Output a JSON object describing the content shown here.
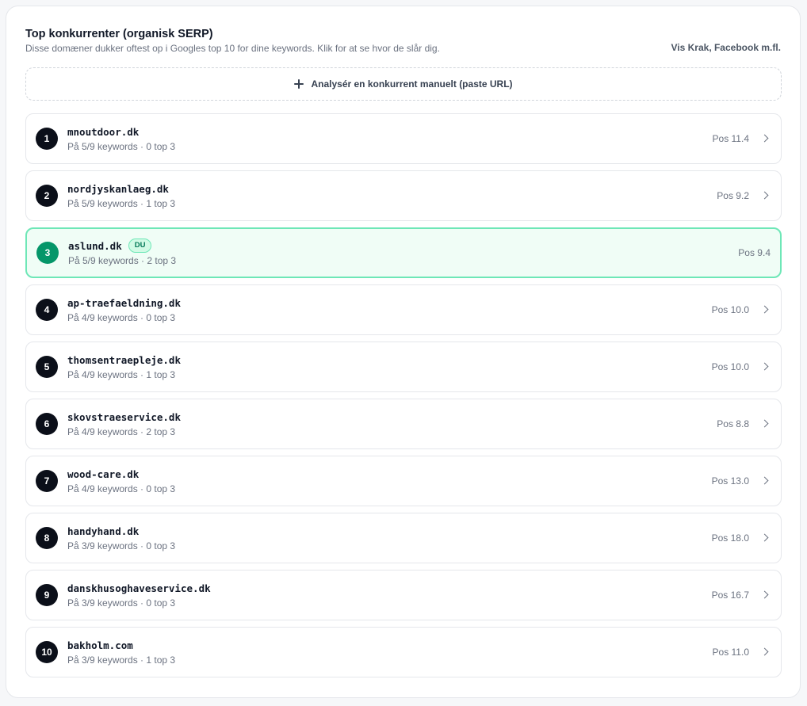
{
  "panel": {
    "title": "Top konkurrenter (organisk SERP)",
    "subtitle": "Disse domæner dukker oftest op i Googles top 10 for dine keywords. Klik for at se hvor de slår dig.",
    "toggle_label": "Vis Krak, Facebook m.fl.",
    "add_label": "Analysér en konkurrent manuelt (paste URL)"
  },
  "competitors": [
    {
      "rank": "1",
      "domain": "mnoutdoor.dk",
      "meta": "På 5/9 keywords · 0 top 3",
      "pos": "Pos 11.4",
      "is_self": false
    },
    {
      "rank": "2",
      "domain": "nordjyskanlaeg.dk",
      "meta": "På 5/9 keywords · 1 top 3",
      "pos": "Pos 9.2",
      "is_self": false
    },
    {
      "rank": "3",
      "domain": "aslund.dk",
      "badge": "DU",
      "meta": "På 5/9 keywords · 2 top 3",
      "pos": "Pos 9.4",
      "is_self": true
    },
    {
      "rank": "4",
      "domain": "ap-traefaeldning.dk",
      "meta": "På 4/9 keywords · 0 top 3",
      "pos": "Pos 10.0",
      "is_self": false
    },
    {
      "rank": "5",
      "domain": "thomsentraepleje.dk",
      "meta": "På 4/9 keywords · 1 top 3",
      "pos": "Pos 10.0",
      "is_self": false
    },
    {
      "rank": "6",
      "domain": "skovstraeservice.dk",
      "meta": "På 4/9 keywords · 2 top 3",
      "pos": "Pos 8.8",
      "is_self": false
    },
    {
      "rank": "7",
      "domain": "wood-care.dk",
      "meta": "På 4/9 keywords · 0 top 3",
      "pos": "Pos 13.0",
      "is_self": false
    },
    {
      "rank": "8",
      "domain": "handyhand.dk",
      "meta": "På 3/9 keywords · 0 top 3",
      "pos": "Pos 18.0",
      "is_self": false
    },
    {
      "rank": "9",
      "domain": "danskhusoghaveservice.dk",
      "meta": "På 3/9 keywords · 0 top 3",
      "pos": "Pos 16.7",
      "is_self": false
    },
    {
      "rank": "10",
      "domain": "bakholm.com",
      "meta": "På 3/9 keywords · 1 top 3",
      "pos": "Pos 11.0",
      "is_self": false
    }
  ]
}
